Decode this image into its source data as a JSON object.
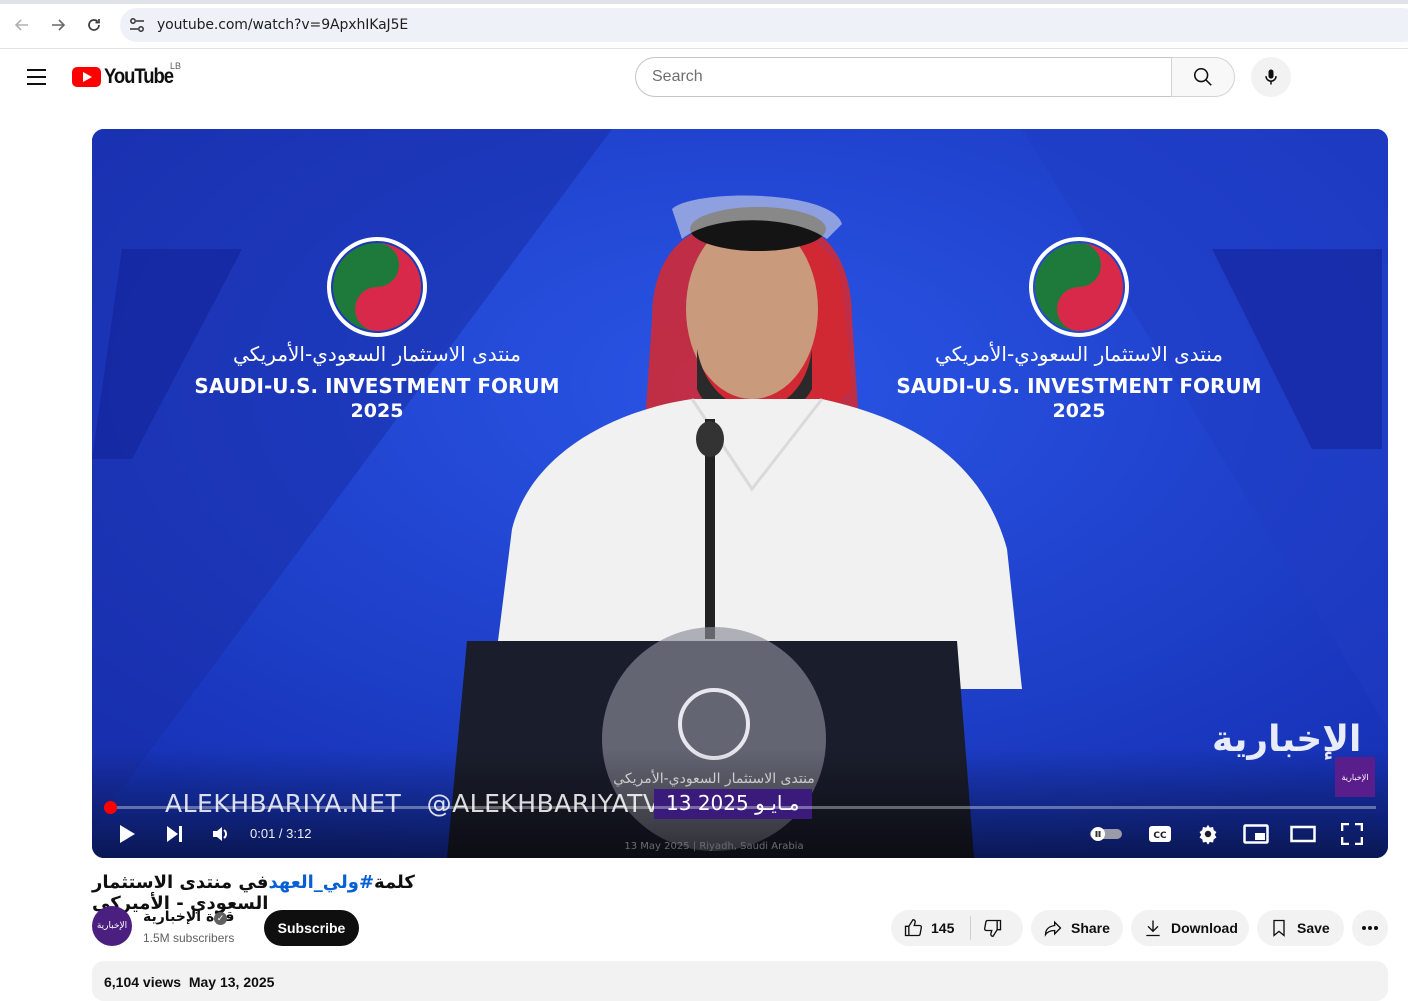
{
  "browser": {
    "url": "youtube.com/watch?v=9ApxhIKaJ5E"
  },
  "masthead": {
    "logo_text": "YouTube",
    "region": "LB",
    "search_placeholder": "Search"
  },
  "player": {
    "watermark_site": "ALEKHBARIYA.NET",
    "watermark_handle": "@ALEKHBARIYATV",
    "date_overlay": "13 مـايـو 2025",
    "channel_brand": "الإخبارية",
    "chip_text": "الإخبارية",
    "time_display": "0:01 / 3:12",
    "progress": 0.005,
    "accent_color": "#ff0000"
  },
  "video": {
    "title_prefix": "كلمة",
    "title_hashtag": "#ولي_العهد",
    "title_suffix": "في منتدى الاستثمار السعودي - الأميركي",
    "channel_name": "قناة الإخبارية",
    "avatar_text": "الإخبارية",
    "subscribers": "1.5M subscribers",
    "subscribe_label": "Subscribe",
    "likes": "145",
    "share_label": "Share",
    "download_label": "Download",
    "save_label": "Save",
    "views": "6,104 views",
    "date": "May 13, 2025"
  }
}
